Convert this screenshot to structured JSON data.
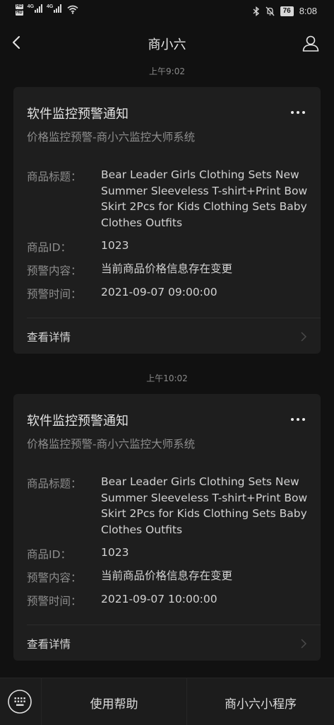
{
  "status_bar": {
    "hd1": "HD",
    "hd2": "HD",
    "net1": "4G",
    "net2": "4G",
    "battery": "76",
    "time": "8:08"
  },
  "header": {
    "title": "商小六"
  },
  "messages": [
    {
      "time": "上午9:02",
      "card_title": "软件监控预警通知",
      "subtitle": "价格监控预警-商小六监控大师系统",
      "product_title_label": "商品标题：",
      "product_title": "Bear Leader Girls Clothing Sets New Summer Sleeveless T-shirt+Print Bow Skirt 2Pcs for Kids Clothing Sets Baby Clothes Outfits",
      "product_id_label": "商品ID：",
      "product_id": "1023",
      "alert_content_label": "预警内容：",
      "alert_content": "当前商品价格信息存在变更",
      "alert_time_label": "预警时间：",
      "alert_time": "2021-09-07 09:00:00",
      "details_link": "查看详情"
    },
    {
      "time": "上午10:02",
      "card_title": "软件监控预警通知",
      "subtitle": "价格监控预警-商小六监控大师系统",
      "product_title_label": "商品标题：",
      "product_title": "Bear Leader Girls Clothing Sets New Summer Sleeveless T-shirt+Print Bow Skirt 2Pcs for Kids Clothing Sets Baby Clothes Outfits",
      "product_id_label": "商品ID：",
      "product_id": "1023",
      "alert_content_label": "预警内容：",
      "alert_content": "当前商品价格信息存在变更",
      "alert_time_label": "预警时间：",
      "alert_time": "2021-09-07 10:00:00",
      "details_link": "查看详情"
    }
  ],
  "bottom_menu": {
    "help": "使用帮助",
    "mini_program": "商小六小程序"
  },
  "icons": {
    "back": "chevron-left-icon",
    "profile": "person-icon",
    "more": "more-dots-icon",
    "keyboard": "keyboard-icon",
    "details": "chevron-right-icon"
  }
}
